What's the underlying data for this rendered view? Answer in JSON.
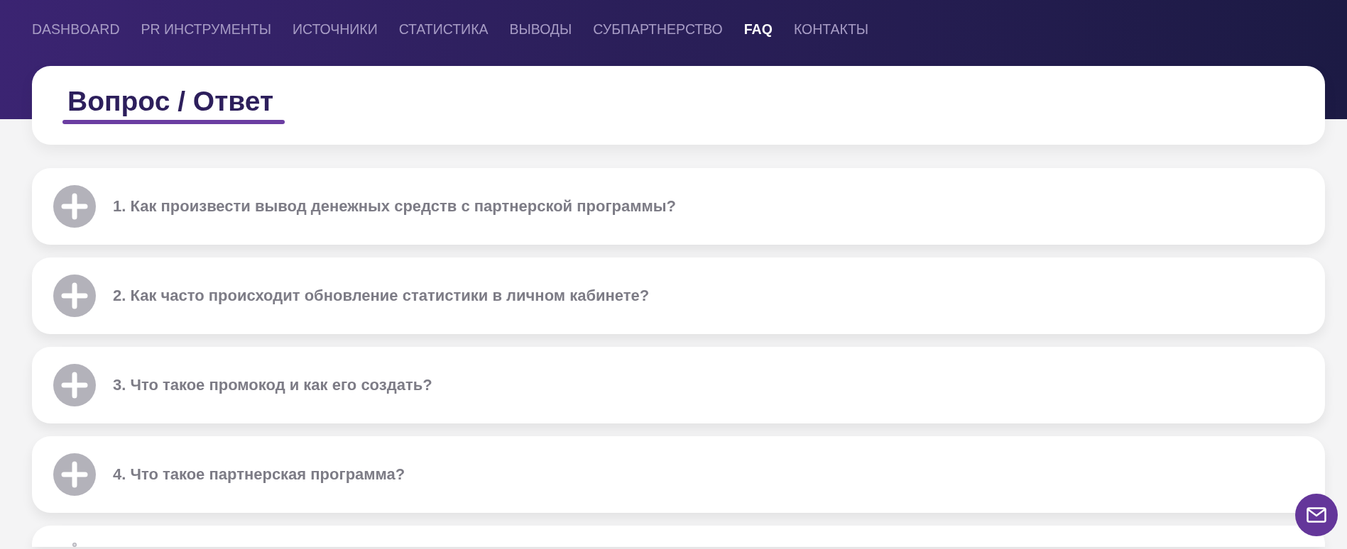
{
  "nav": [
    {
      "label": "DASHBOARD",
      "selected": false
    },
    {
      "label": "PR ИНСТРУМЕНТЫ",
      "selected": false
    },
    {
      "label": "ИСТОЧНИКИ",
      "selected": false
    },
    {
      "label": "СТАТИСТИКА",
      "selected": false
    },
    {
      "label": "ВЫВОДЫ",
      "selected": false
    },
    {
      "label": "СУБПАРТНЕРСТВО",
      "selected": false
    },
    {
      "label": "FAQ",
      "selected": true
    },
    {
      "label": "КОНТАКТЫ",
      "selected": false
    }
  ],
  "page_title": "Вопрос / Ответ",
  "faq": [
    {
      "question": "1. Как произвести вывод денежных средств с партнерской программы?",
      "expanded": false
    },
    {
      "question": "2. Как часто происходит обновление статистики в личном кабинете?",
      "expanded": false
    },
    {
      "question": "3. Что такое промокод и как его создать?",
      "expanded": false
    },
    {
      "question": "4. Что такое партнерская программа?",
      "expanded": false
    },
    {
      "kind": "cut"
    }
  ],
  "contact_button": {
    "kind": "mail"
  }
}
